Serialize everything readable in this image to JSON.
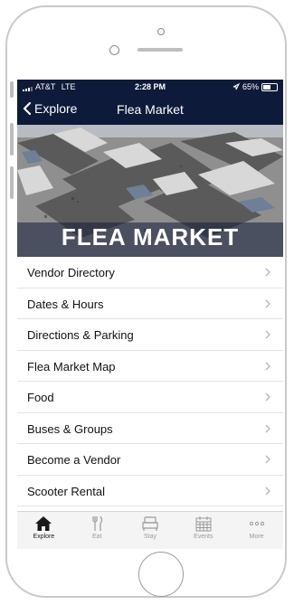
{
  "status": {
    "carrier": "AT&T",
    "network": "LTE",
    "time": "2:28 PM",
    "battery": "65%",
    "battery_level": 0.65
  },
  "nav": {
    "back_label": "Explore",
    "title": "Flea Market"
  },
  "hero": {
    "title": "FLEA MARKET"
  },
  "menu": {
    "items": [
      {
        "label": "Vendor Directory"
      },
      {
        "label": "Dates & Hours"
      },
      {
        "label": "Directions & Parking"
      },
      {
        "label": "Flea Market Map"
      },
      {
        "label": "Food"
      },
      {
        "label": "Buses & Groups"
      },
      {
        "label": "Become a Vendor"
      },
      {
        "label": "Scooter Rental"
      }
    ]
  },
  "tabs": [
    {
      "label": "Explore",
      "icon": "home-icon",
      "active": true
    },
    {
      "label": "Eat",
      "icon": "fork-knife-icon"
    },
    {
      "label": "Stay",
      "icon": "bed-icon"
    },
    {
      "label": "Events",
      "icon": "calendar-icon"
    },
    {
      "label": "More",
      "icon": "more-dots-icon"
    }
  ],
  "colors": {
    "navbar": "#0d1a3a",
    "tabbar": "#f4f4f4"
  }
}
